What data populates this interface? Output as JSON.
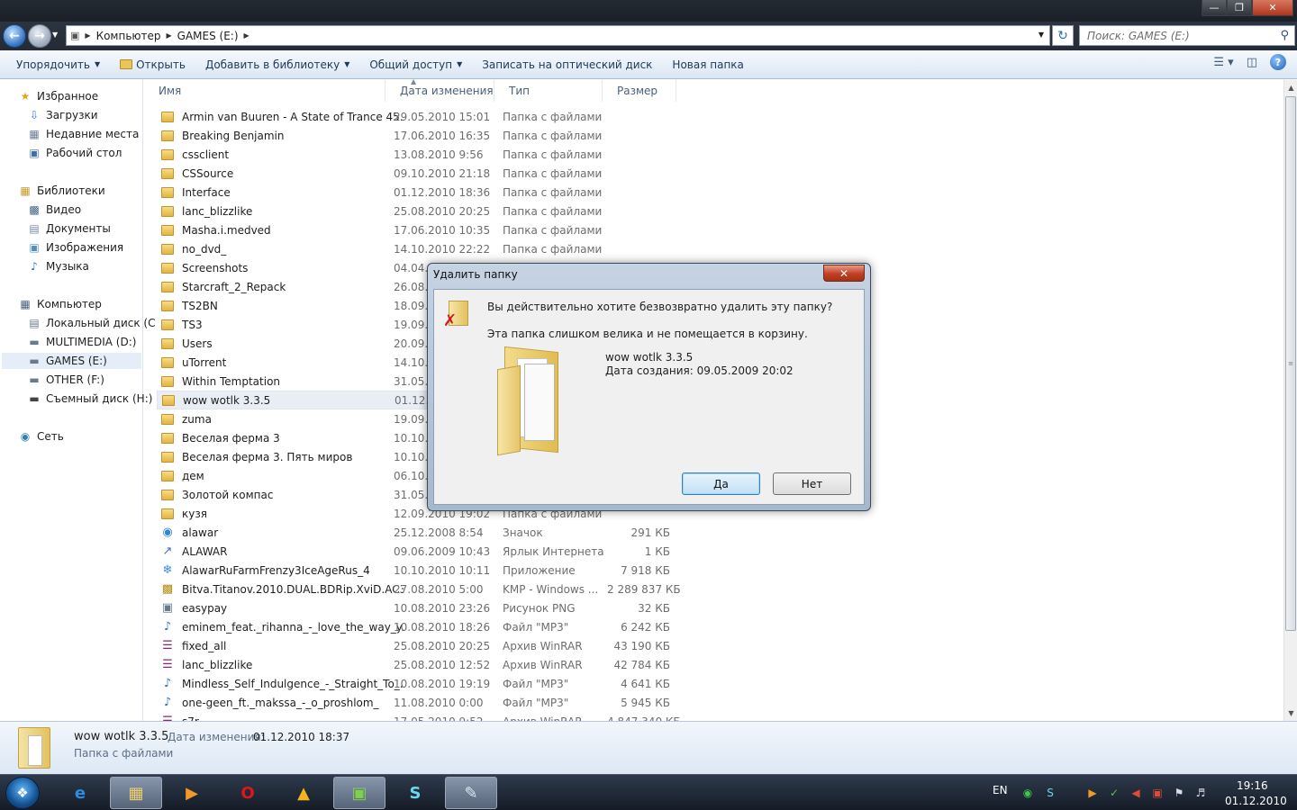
{
  "address": {
    "segments": [
      "Компьютер",
      "GAMES (E:)"
    ],
    "search_placeholder": "Поиск: GAMES (E:)"
  },
  "toolbar": {
    "organize": "Упорядочить",
    "open": "Открыть",
    "add_to_library": "Добавить в библиотеку",
    "share": "Общий доступ",
    "burn": "Записать на оптический диск",
    "new_folder": "Новая папка"
  },
  "nav": {
    "favorites": "Избранное",
    "downloads": "Загрузки",
    "recent": "Недавние места",
    "desktop": "Рабочий стол",
    "libraries": "Библиотеки",
    "video": "Видео",
    "documents": "Документы",
    "images": "Изображения",
    "music": "Музыка",
    "computer": "Компьютер",
    "drive_c": "Локальный диск (C",
    "drive_d": "MULTIMEDIA (D:)",
    "drive_e": "GAMES (E:)",
    "drive_f": "OTHER (F:)",
    "drive_h": "Съемный диск (H:)",
    "network": "Сеть"
  },
  "columns": {
    "name": "Имя",
    "date": "Дата изменения",
    "type": "Тип",
    "size": "Размер"
  },
  "files": [
    {
      "name": "Armin van Buuren - A State of Trance 45...",
      "date": "29.05.2010 15:01",
      "type": "Папка с файлами",
      "size": "",
      "icon": "folder-icon"
    },
    {
      "name": "Breaking Benjamin",
      "date": "17.06.2010 16:35",
      "type": "Папка с файлами",
      "size": "",
      "icon": "folder-icon"
    },
    {
      "name": "cssclient",
      "date": "13.08.2010 9:56",
      "type": "Папка с файлами",
      "size": "",
      "icon": "folder-icon"
    },
    {
      "name": "CSSource",
      "date": "09.10.2010 21:18",
      "type": "Папка с файлами",
      "size": "",
      "icon": "folder-icon"
    },
    {
      "name": "Interface",
      "date": "01.12.2010 18:36",
      "type": "Папка с файлами",
      "size": "",
      "icon": "folder-icon"
    },
    {
      "name": "lanc_blizzlike",
      "date": "25.08.2010 20:25",
      "type": "Папка с файлами",
      "size": "",
      "icon": "folder-icon"
    },
    {
      "name": "Masha.i.medved",
      "date": "17.06.2010 10:35",
      "type": "Папка с файлами",
      "size": "",
      "icon": "folder-icon"
    },
    {
      "name": "no_dvd_",
      "date": "14.10.2010 22:22",
      "type": "Папка с файлами",
      "size": "",
      "icon": "folder-icon"
    },
    {
      "name": "Screenshots",
      "date": "04.04.2",
      "type": "",
      "size": "",
      "icon": "folder-icon"
    },
    {
      "name": "Starcraft_2_Repack",
      "date": "26.08.2",
      "type": "",
      "size": "",
      "icon": "folder-icon"
    },
    {
      "name": "TS2BN",
      "date": "18.09.2",
      "type": "",
      "size": "",
      "icon": "folder-icon"
    },
    {
      "name": "TS3",
      "date": "19.09.2",
      "type": "",
      "size": "",
      "icon": "folder-icon"
    },
    {
      "name": "Users",
      "date": "20.09.2",
      "type": "",
      "size": "",
      "icon": "folder-icon"
    },
    {
      "name": "uTorrent",
      "date": "14.10.2",
      "type": "",
      "size": "",
      "icon": "folder-icon"
    },
    {
      "name": "Within Temptation",
      "date": "31.05.2",
      "type": "",
      "size": "",
      "icon": "folder-icon"
    },
    {
      "name": "wow wotlk 3.3.5",
      "date": "01.12.2",
      "type": "",
      "size": "",
      "icon": "folder-icon",
      "highlighted": true
    },
    {
      "name": "zuma",
      "date": "19.09.2",
      "type": "",
      "size": "",
      "icon": "folder-icon"
    },
    {
      "name": "Веселая ферма 3",
      "date": "10.10.2",
      "type": "",
      "size": "",
      "icon": "folder-icon"
    },
    {
      "name": "Веселая ферма 3. Пять миров",
      "date": "10.10.2",
      "type": "",
      "size": "",
      "icon": "folder-icon"
    },
    {
      "name": "дем",
      "date": "06.10.2",
      "type": "",
      "size": "",
      "icon": "folder-icon"
    },
    {
      "name": "Золотой компас",
      "date": "31.05.2",
      "type": "",
      "size": "",
      "icon": "folder-icon"
    },
    {
      "name": "кузя",
      "date": "12.09.2010 19:02",
      "type": "Папка с файлами",
      "size": "",
      "icon": "folder-icon"
    },
    {
      "name": "alawar",
      "date": "25.12.2008 8:54",
      "type": "Значок",
      "size": "291 КБ",
      "icon": "ico-file-icon"
    },
    {
      "name": "ALAWAR",
      "date": "09.06.2009 10:43",
      "type": "Ярлык Интернета",
      "size": "1 КБ",
      "icon": "url-shortcut-icon"
    },
    {
      "name": "AlawarRuFarmFrenzy3IceAgeRus_4",
      "date": "10.10.2010 10:11",
      "type": "Приложение",
      "size": "7 918 КБ",
      "icon": "application-icon"
    },
    {
      "name": "Bitva.Titanov.2010.DUAL.BDRip.XviD.AC3...",
      "date": "27.08.2010 5:00",
      "type": "KMP - Windows ...",
      "size": "2 289 837 КБ",
      "icon": "video-file-icon"
    },
    {
      "name": "easypay",
      "date": "10.08.2010 23:26",
      "type": "Рисунок PNG",
      "size": "32 КБ",
      "icon": "png-file-icon"
    },
    {
      "name": "eminem_feat._rihanna_-_love_the_way_y...",
      "date": "10.08.2010 18:26",
      "type": "Файл \"MP3\"",
      "size": "6 242 КБ",
      "icon": "mp3-file-icon"
    },
    {
      "name": "fixed_all",
      "date": "25.08.2010 20:25",
      "type": "Архив WinRAR",
      "size": "43 190 КБ",
      "icon": "rar-archive-icon"
    },
    {
      "name": "lanc_blizzlike",
      "date": "25.08.2010 12:52",
      "type": "Архив WinRAR",
      "size": "42 784 КБ",
      "icon": "rar-archive-icon"
    },
    {
      "name": "Mindless_Self_Indulgence_-_Straight_To_...",
      "date": "10.08.2010 19:19",
      "type": "Файл \"MP3\"",
      "size": "4 641 КБ",
      "icon": "mp3-file-icon"
    },
    {
      "name": "one-geen_ft._makssa_-_o_proshlom_",
      "date": "11.08.2010 0:00",
      "type": "Файл \"MP3\"",
      "size": "5 945 КБ",
      "icon": "mp3-file-icon"
    },
    {
      "name": "s7r",
      "date": "17.05.2010 9:52",
      "type": "Архив WinRAR",
      "size": "4 847 340 КБ",
      "icon": "rar-archive-icon"
    }
  ],
  "details": {
    "name": "wow wotlk 3.3.5",
    "modified_label": "Дата изменения:",
    "modified_value": "01.12.2010 18:37",
    "type": "Папка с файлами"
  },
  "dialog": {
    "title": "Удалить папку",
    "question": "Вы действительно хотите безвозвратно удалить эту папку?",
    "note": "Эта папка слишком велика и не помещается в корзину.",
    "folder_name": "wow wotlk 3.3.5",
    "created": "Дата создания: 09.05.2009 20:02",
    "yes": "Да",
    "no": "Нет"
  },
  "taskbar": {
    "lang": "EN",
    "time": "19:16",
    "date": "01.12.2010"
  },
  "colors": {
    "accent": "#2f6fc0",
    "close": "#c13f24",
    "folder": "#e3b443"
  }
}
